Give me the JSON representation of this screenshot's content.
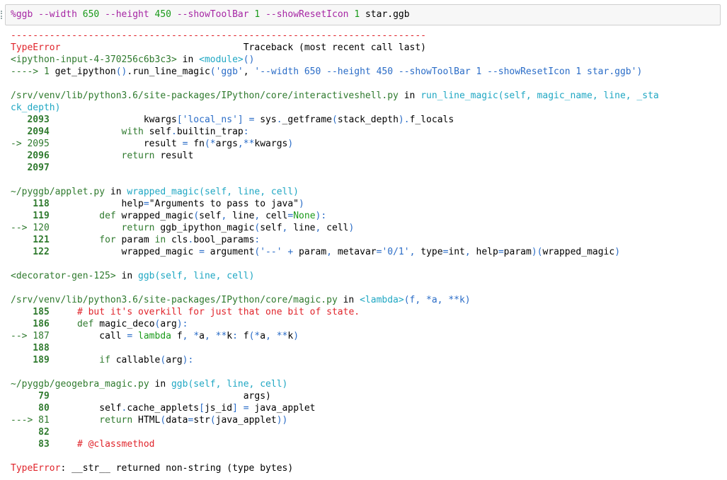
{
  "input": {
    "magic": "%ggb",
    "parts": [
      {
        "t": " ",
        "c": ""
      },
      {
        "t": "--width",
        "c": "magenta"
      },
      {
        "t": " ",
        "c": ""
      },
      {
        "t": "650",
        "c": "green"
      },
      {
        "t": " ",
        "c": ""
      },
      {
        "t": "--height",
        "c": "magenta"
      },
      {
        "t": " ",
        "c": ""
      },
      {
        "t": "450",
        "c": "green"
      },
      {
        "t": " ",
        "c": ""
      },
      {
        "t": "--showToolBar",
        "c": "magenta"
      },
      {
        "t": " ",
        "c": ""
      },
      {
        "t": "1",
        "c": "green"
      },
      {
        "t": " ",
        "c": ""
      },
      {
        "t": "--showResetIcon",
        "c": "magenta"
      },
      {
        "t": " ",
        "c": ""
      },
      {
        "t": "1",
        "c": "green"
      },
      {
        "t": " star.ggb",
        "c": ""
      }
    ]
  },
  "traceback": [
    [
      {
        "t": "---------------------------------------------------------------------------",
        "c": "red"
      }
    ],
    [
      {
        "t": "TypeError",
        "c": "red"
      },
      {
        "t": "                                 Traceback (most recent call last)",
        "c": ""
      }
    ],
    [
      {
        "t": "<ipython-input-4-370256c6b3c3>",
        "c": "dkgreen"
      },
      {
        "t": " in ",
        "c": ""
      },
      {
        "t": "<module>",
        "c": "cyan"
      },
      {
        "t": "()",
        "c": "blue"
      }
    ],
    [
      {
        "t": "----> 1",
        "c": "dkgreen"
      },
      {
        "t": " get_ipython",
        "c": ""
      },
      {
        "t": "()",
        "c": "blue"
      },
      {
        "t": ".",
        "c": ""
      },
      {
        "t": "run_line_magic",
        "c": ""
      },
      {
        "t": "(",
        "c": "blue"
      },
      {
        "t": "'ggb'",
        "c": "blue"
      },
      {
        "t": ", ",
        "c": ""
      },
      {
        "t": "'--width 650 --height 450 --showToolBar 1 --showResetIcon 1 star.ggb'",
        "c": "blue"
      },
      {
        "t": ")",
        "c": "blue"
      }
    ],
    [],
    [
      {
        "t": "/srv/venv/lib/python3.6/site-packages/IPython/core/interactiveshell.py",
        "c": "dkgreen"
      },
      {
        "t": " in ",
        "c": ""
      },
      {
        "t": "run_line_magic(self, magic_name, line, _sta",
        "c": "cyan"
      }
    ],
    [
      {
        "t": "ck_depth)",
        "c": "cyan"
      }
    ],
    [
      {
        "t": "   2093",
        "c": "dkgreen bold"
      },
      {
        "t": "                 kwargs",
        "c": ""
      },
      {
        "t": "[",
        "c": "blue"
      },
      {
        "t": "'local_ns'",
        "c": "blue"
      },
      {
        "t": "]",
        "c": "blue"
      },
      {
        "t": " ",
        "c": ""
      },
      {
        "t": "=",
        "c": "blue"
      },
      {
        "t": " sys",
        "c": ""
      },
      {
        "t": ".",
        "c": "blue"
      },
      {
        "t": "_getframe",
        "c": ""
      },
      {
        "t": "(",
        "c": "blue"
      },
      {
        "t": "stack_depth",
        "c": ""
      },
      {
        "t": ")",
        "c": "blue"
      },
      {
        "t": ".",
        "c": "blue"
      },
      {
        "t": "f_locals",
        "c": ""
      }
    ],
    [
      {
        "t": "   2094",
        "c": "dkgreen bold"
      },
      {
        "t": "             ",
        "c": ""
      },
      {
        "t": "with",
        "c": "dkgreen"
      },
      {
        "t": " self",
        "c": ""
      },
      {
        "t": ".",
        "c": "blue"
      },
      {
        "t": "builtin_trap",
        "c": ""
      },
      {
        "t": ":",
        "c": "blue"
      }
    ],
    [
      {
        "t": "-> 2095",
        "c": "dkgreen"
      },
      {
        "t": "                 result ",
        "c": ""
      },
      {
        "t": "=",
        "c": "blue"
      },
      {
        "t": " fn",
        "c": ""
      },
      {
        "t": "(",
        "c": "blue"
      },
      {
        "t": "*",
        "c": "blue"
      },
      {
        "t": "args",
        "c": ""
      },
      {
        "t": ",",
        "c": "blue"
      },
      {
        "t": "**",
        "c": "blue"
      },
      {
        "t": "kwargs",
        "c": ""
      },
      {
        "t": ")",
        "c": "blue"
      }
    ],
    [
      {
        "t": "   2096",
        "c": "dkgreen bold"
      },
      {
        "t": "             ",
        "c": ""
      },
      {
        "t": "return",
        "c": "dkgreen"
      },
      {
        "t": " result",
        "c": ""
      }
    ],
    [
      {
        "t": "   2097",
        "c": "dkgreen bold"
      }
    ],
    [],
    [
      {
        "t": "~/pyggb/applet.py",
        "c": "dkgreen"
      },
      {
        "t": " in ",
        "c": ""
      },
      {
        "t": "wrapped_magic(self, line, cell)",
        "c": "cyan"
      }
    ],
    [
      {
        "t": "    118",
        "c": "dkgreen bold"
      },
      {
        "t": "             help",
        "c": ""
      },
      {
        "t": "=",
        "c": "blue"
      },
      {
        "t": "\"Arguments to pass to java\"",
        "c": ""
      },
      {
        "t": ")",
        "c": "blue"
      }
    ],
    [
      {
        "t": "    119",
        "c": "dkgreen bold"
      },
      {
        "t": "         ",
        "c": ""
      },
      {
        "t": "def",
        "c": "dkgreen"
      },
      {
        "t": " wrapped_magic",
        "c": ""
      },
      {
        "t": "(",
        "c": "blue"
      },
      {
        "t": "self",
        "c": ""
      },
      {
        "t": ",",
        "c": "blue"
      },
      {
        "t": " line",
        "c": ""
      },
      {
        "t": ",",
        "c": "blue"
      },
      {
        "t": " cell",
        "c": ""
      },
      {
        "t": "=",
        "c": "blue"
      },
      {
        "t": "None",
        "c": "green"
      },
      {
        "t": "):",
        "c": "blue"
      }
    ],
    [
      {
        "t": "--> 120",
        "c": "dkgreen"
      },
      {
        "t": "             ",
        "c": ""
      },
      {
        "t": "return",
        "c": "dkgreen"
      },
      {
        "t": " ggb_ipython_magic",
        "c": ""
      },
      {
        "t": "(",
        "c": "blue"
      },
      {
        "t": "self",
        "c": ""
      },
      {
        "t": ",",
        "c": "blue"
      },
      {
        "t": " line",
        "c": ""
      },
      {
        "t": ",",
        "c": "blue"
      },
      {
        "t": " cell",
        "c": ""
      },
      {
        "t": ")",
        "c": "blue"
      }
    ],
    [
      {
        "t": "    121",
        "c": "dkgreen bold"
      },
      {
        "t": "         ",
        "c": ""
      },
      {
        "t": "for",
        "c": "dkgreen"
      },
      {
        "t": " param ",
        "c": ""
      },
      {
        "t": "in",
        "c": "dkgreen"
      },
      {
        "t": " cls",
        "c": ""
      },
      {
        "t": ".",
        "c": "blue"
      },
      {
        "t": "bool_params",
        "c": ""
      },
      {
        "t": ":",
        "c": "blue"
      }
    ],
    [
      {
        "t": "    122",
        "c": "dkgreen bold"
      },
      {
        "t": "             wrapped_magic ",
        "c": ""
      },
      {
        "t": "=",
        "c": "blue"
      },
      {
        "t": " argument",
        "c": ""
      },
      {
        "t": "(",
        "c": "blue"
      },
      {
        "t": "'--'",
        "c": "blue"
      },
      {
        "t": " ",
        "c": ""
      },
      {
        "t": "+",
        "c": "blue"
      },
      {
        "t": " param",
        "c": ""
      },
      {
        "t": ",",
        "c": "blue"
      },
      {
        "t": " metavar",
        "c": ""
      },
      {
        "t": "=",
        "c": "blue"
      },
      {
        "t": "'0/1'",
        "c": "blue"
      },
      {
        "t": ",",
        "c": "blue"
      },
      {
        "t": " type",
        "c": ""
      },
      {
        "t": "=",
        "c": "blue"
      },
      {
        "t": "int",
        "c": ""
      },
      {
        "t": ",",
        "c": "blue"
      },
      {
        "t": " help",
        "c": ""
      },
      {
        "t": "=",
        "c": "blue"
      },
      {
        "t": "param",
        "c": ""
      },
      {
        "t": ")(",
        "c": "blue"
      },
      {
        "t": "wrapped_magic",
        "c": ""
      },
      {
        "t": ")",
        "c": "blue"
      }
    ],
    [],
    [
      {
        "t": "<decorator-gen-125>",
        "c": "dkgreen"
      },
      {
        "t": " in ",
        "c": ""
      },
      {
        "t": "ggb(self, line, cell)",
        "c": "cyan"
      }
    ],
    [],
    [
      {
        "t": "/srv/venv/lib/python3.6/site-packages/IPython/core/magic.py",
        "c": "dkgreen"
      },
      {
        "t": " in ",
        "c": ""
      },
      {
        "t": "<lambda>",
        "c": "cyan"
      },
      {
        "t": "(f, *a, **k)",
        "c": "blue"
      }
    ],
    [
      {
        "t": "    185",
        "c": "dkgreen bold"
      },
      {
        "t": "     ",
        "c": ""
      },
      {
        "t": "# but it's overkill for just that one bit of state.",
        "c": "red"
      }
    ],
    [
      {
        "t": "    186",
        "c": "dkgreen bold"
      },
      {
        "t": "     ",
        "c": ""
      },
      {
        "t": "def",
        "c": "dkgreen"
      },
      {
        "t": " magic_deco",
        "c": ""
      },
      {
        "t": "(",
        "c": "blue"
      },
      {
        "t": "arg",
        "c": ""
      },
      {
        "t": "):",
        "c": "blue"
      }
    ],
    [
      {
        "t": "--> 187",
        "c": "dkgreen"
      },
      {
        "t": "         call ",
        "c": ""
      },
      {
        "t": "=",
        "c": "blue"
      },
      {
        "t": " ",
        "c": ""
      },
      {
        "t": "lambda",
        "c": "green"
      },
      {
        "t": " f",
        "c": ""
      },
      {
        "t": ",",
        "c": "blue"
      },
      {
        "t": " ",
        "c": ""
      },
      {
        "t": "*",
        "c": "blue"
      },
      {
        "t": "a",
        "c": ""
      },
      {
        "t": ",",
        "c": "blue"
      },
      {
        "t": " ",
        "c": ""
      },
      {
        "t": "**",
        "c": "blue"
      },
      {
        "t": "k",
        "c": ""
      },
      {
        "t": ":",
        "c": "blue"
      },
      {
        "t": " f",
        "c": ""
      },
      {
        "t": "(",
        "c": "blue"
      },
      {
        "t": "*",
        "c": "blue"
      },
      {
        "t": "a",
        "c": ""
      },
      {
        "t": ",",
        "c": "blue"
      },
      {
        "t": " ",
        "c": ""
      },
      {
        "t": "**",
        "c": "blue"
      },
      {
        "t": "k",
        "c": ""
      },
      {
        "t": ")",
        "c": "blue"
      }
    ],
    [
      {
        "t": "    188",
        "c": "dkgreen bold"
      }
    ],
    [
      {
        "t": "    189",
        "c": "dkgreen bold"
      },
      {
        "t": "         ",
        "c": ""
      },
      {
        "t": "if",
        "c": "dkgreen"
      },
      {
        "t": " callable",
        "c": ""
      },
      {
        "t": "(",
        "c": "blue"
      },
      {
        "t": "arg",
        "c": ""
      },
      {
        "t": "):",
        "c": "blue"
      }
    ],
    [],
    [
      {
        "t": "~/pyggb/geogebra_magic.py",
        "c": "dkgreen"
      },
      {
        "t": " in ",
        "c": ""
      },
      {
        "t": "ggb(self, line, cell)",
        "c": "cyan"
      }
    ],
    [
      {
        "t": "     79",
        "c": "dkgreen bold"
      },
      {
        "t": "                                   args)",
        "c": ""
      }
    ],
    [
      {
        "t": "     80",
        "c": "dkgreen bold"
      },
      {
        "t": "         self",
        "c": ""
      },
      {
        "t": ".",
        "c": "blue"
      },
      {
        "t": "cache_applets",
        "c": ""
      },
      {
        "t": "[",
        "c": "blue"
      },
      {
        "t": "js_id",
        "c": ""
      },
      {
        "t": "]",
        "c": "blue"
      },
      {
        "t": " ",
        "c": ""
      },
      {
        "t": "=",
        "c": "blue"
      },
      {
        "t": " java_applet",
        "c": ""
      }
    ],
    [
      {
        "t": "---> 81",
        "c": "dkgreen"
      },
      {
        "t": "         ",
        "c": ""
      },
      {
        "t": "return",
        "c": "dkgreen"
      },
      {
        "t": " HTML",
        "c": ""
      },
      {
        "t": "(",
        "c": "blue"
      },
      {
        "t": "data",
        "c": ""
      },
      {
        "t": "=",
        "c": "blue"
      },
      {
        "t": "str",
        "c": ""
      },
      {
        "t": "(",
        "c": "blue"
      },
      {
        "t": "java_applet",
        "c": ""
      },
      {
        "t": "))",
        "c": "blue"
      }
    ],
    [
      {
        "t": "     82",
        "c": "dkgreen bold"
      }
    ],
    [
      {
        "t": "     83",
        "c": "dkgreen bold"
      },
      {
        "t": "     ",
        "c": ""
      },
      {
        "t": "# @classmethod",
        "c": "red"
      }
    ],
    [],
    [
      {
        "t": "TypeError",
        "c": "red"
      },
      {
        "t": ": __str__ returned non-string (type bytes)",
        "c": ""
      }
    ]
  ]
}
